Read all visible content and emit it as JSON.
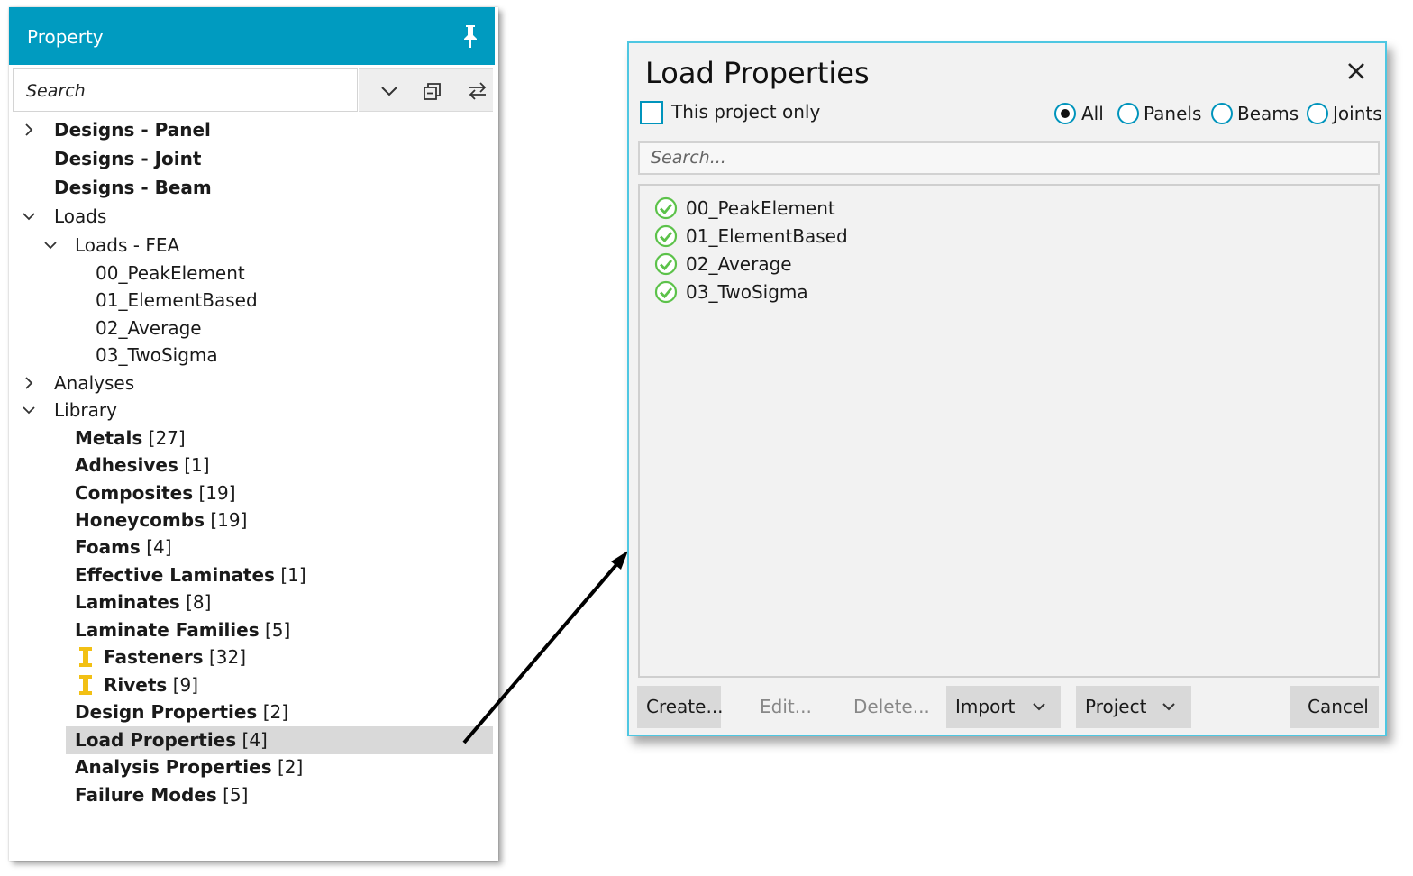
{
  "property_panel": {
    "title": "Property",
    "search_placeholder": "Search",
    "tree": {
      "designs_panel": "Designs - Panel",
      "designs_joint": "Designs - Joint",
      "designs_beam": "Designs - Beam",
      "loads": "Loads",
      "loads_fea": "Loads - FEA",
      "load_items": [
        "00_PeakElement",
        "01_ElementBased",
        "02_Average",
        "03_TwoSigma"
      ],
      "analyses": "Analyses",
      "library": "Library",
      "library_items": [
        {
          "name": "Metals",
          "count": "[27]"
        },
        {
          "name": "Adhesives",
          "count": "[1]"
        },
        {
          "name": "Composites",
          "count": "[19]"
        },
        {
          "name": "Honeycombs",
          "count": "[19]"
        },
        {
          "name": "Foams",
          "count": "[4]"
        },
        {
          "name": "Effective Laminates",
          "count": "[1]"
        },
        {
          "name": "Laminates",
          "count": "[8]"
        },
        {
          "name": "Laminate Families",
          "count": "[5]"
        },
        {
          "name": "Fasteners",
          "count": "[32]"
        },
        {
          "name": "Rivets",
          "count": "[9]"
        },
        {
          "name": "Design Properties",
          "count": "[2]"
        },
        {
          "name": "Load Properties",
          "count": "[4]"
        },
        {
          "name": "Analysis Properties",
          "count": "[2]"
        },
        {
          "name": "Failure Modes",
          "count": "[5]"
        }
      ]
    }
  },
  "dialog": {
    "title": "Load Properties",
    "project_only_label": "This project only",
    "filters": {
      "all": "All",
      "panels": "Panels",
      "beams": "Beams",
      "joints": "Joints"
    },
    "selected_filter": "All",
    "search_placeholder": "Search...",
    "items": [
      "00_PeakElement",
      "01_ElementBased",
      "02_Average",
      "03_TwoSigma"
    ],
    "buttons": {
      "create": "Create...",
      "edit": "Edit...",
      "delete": "Delete...",
      "import": "Import",
      "project": "Project",
      "cancel": "Cancel"
    }
  },
  "colors": {
    "header": "#009bc0",
    "dialog_border": "#4ec7e2",
    "radio_border": "#0094bc",
    "check_ok": "#5cc24a",
    "fastener_icon": "#f2c014",
    "selection": "#d9d9d9"
  },
  "icons": {
    "pin": "pin-icon",
    "dropdown": "chevron-down-icon",
    "collapse_all": "collapse-all-icon",
    "swap": "swap-arrows-icon",
    "expand": "chevron-right-icon",
    "collapse": "chevron-down-icon",
    "close": "close-icon",
    "valid": "check-circle-icon",
    "fastener": "fastener-icon"
  }
}
